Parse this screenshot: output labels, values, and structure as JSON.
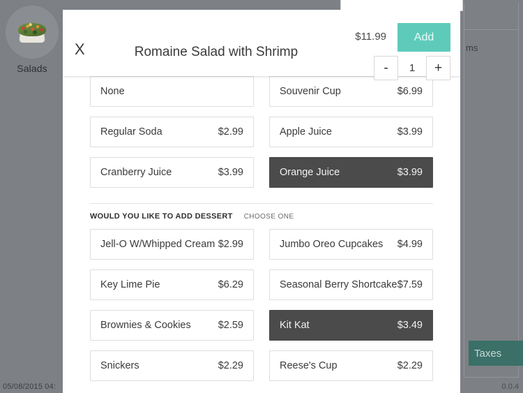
{
  "background": {
    "category": {
      "label": "Salads",
      "icon": "salad-bowl-icon"
    },
    "order_panel": {
      "column_title": "ms",
      "taxes_label": "Taxes"
    },
    "status_bar": {
      "datetime": "05/08/2015 04:",
      "version": "0.0.4"
    }
  },
  "modal": {
    "close_label": "X",
    "title": "Romaine Salad with Shrimp",
    "price": "$11.99",
    "add_label": "Add",
    "quantity": {
      "decrement_label": "-",
      "value": "1",
      "increment_label": "+"
    },
    "sections": [
      {
        "id": "drinks",
        "title": "",
        "hint": "",
        "show_header": false,
        "options": [
          {
            "name": "None",
            "price": "",
            "selected": false
          },
          {
            "name": "Souvenir Cup",
            "price": "$6.99",
            "selected": false
          },
          {
            "name": "Regular Soda",
            "price": "$2.99",
            "selected": false
          },
          {
            "name": "Apple Juice",
            "price": "$3.99",
            "selected": false
          },
          {
            "name": "Cranberry Juice",
            "price": "$3.99",
            "selected": false
          },
          {
            "name": "Orange Juice",
            "price": "$3.99",
            "selected": true
          }
        ]
      },
      {
        "id": "dessert",
        "title": "WOULD YOU LIKE TO ADD DESSERT",
        "hint": "CHOOSE ONE",
        "show_header": true,
        "options": [
          {
            "name": "Jell-O W/Whipped Cream",
            "price": "$2.99",
            "selected": false
          },
          {
            "name": "Jumbo Oreo Cupcakes",
            "price": "$4.99",
            "selected": false
          },
          {
            "name": "Key Lime Pie",
            "price": "$6.29",
            "selected": false
          },
          {
            "name": "Seasonal Berry Shortcake",
            "price": "$7.59",
            "selected": false
          },
          {
            "name": "Brownies & Cookies",
            "price": "$2.59",
            "selected": false
          },
          {
            "name": "Kit Kat",
            "price": "$3.49",
            "selected": true
          },
          {
            "name": "Snickers",
            "price": "$2.29",
            "selected": false
          },
          {
            "name": "Reese's Cup",
            "price": "$2.29",
            "selected": false
          }
        ]
      }
    ]
  },
  "colors": {
    "overlay": "#7d8084",
    "accent_add": "#5ecbba",
    "selected": "#4b4b4b",
    "taxes": "#3a7068"
  }
}
